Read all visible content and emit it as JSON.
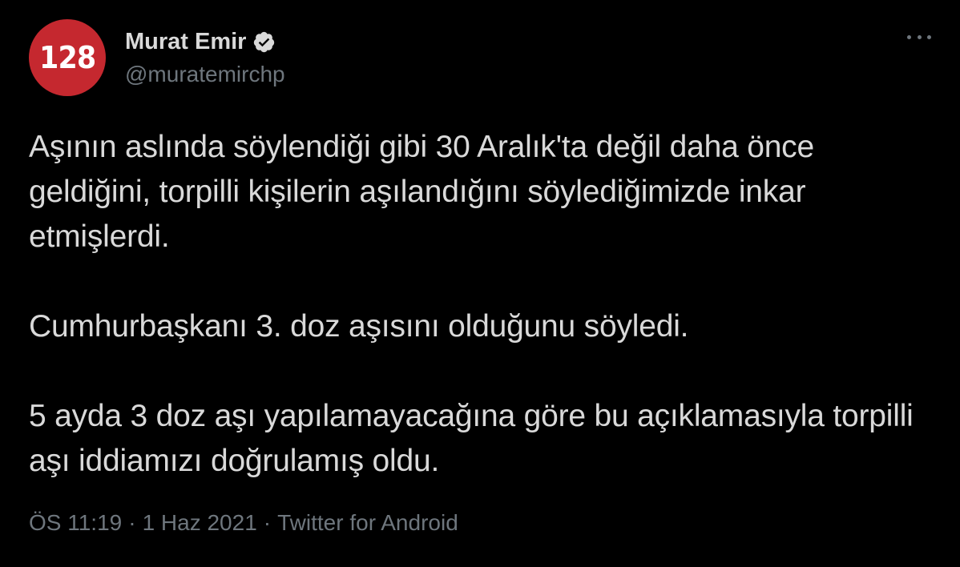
{
  "author": {
    "avatar_text": "128",
    "display_name": "Murat Emir",
    "handle": "@muratemirchp",
    "verified": true
  },
  "tweet": {
    "paragraphs": [
      "Aşının aslında söylendiği gibi 30 Aralık'ta değil daha önce geldiğini, torpilli kişilerin aşılandığını söylediğimizde inkar etmişlerdi.",
      "Cumhurbaşkanı 3. doz aşısını olduğunu söyledi.",
      "5 ayda 3 doz aşı yapılamayacağına göre bu açıklamasıyla torpilli aşı iddiamızı doğrulamış oldu."
    ],
    "time": "ÖS 11:19",
    "date": "1 Haz 2021",
    "source": "Twitter for Android",
    "separator": "·"
  },
  "icons": {
    "verified": "verified-badge-icon",
    "more": "more-options-icon"
  },
  "colors": {
    "background": "#000000",
    "text": "#d9d9d9",
    "muted": "#6e767d",
    "avatar": "#c5282f"
  }
}
